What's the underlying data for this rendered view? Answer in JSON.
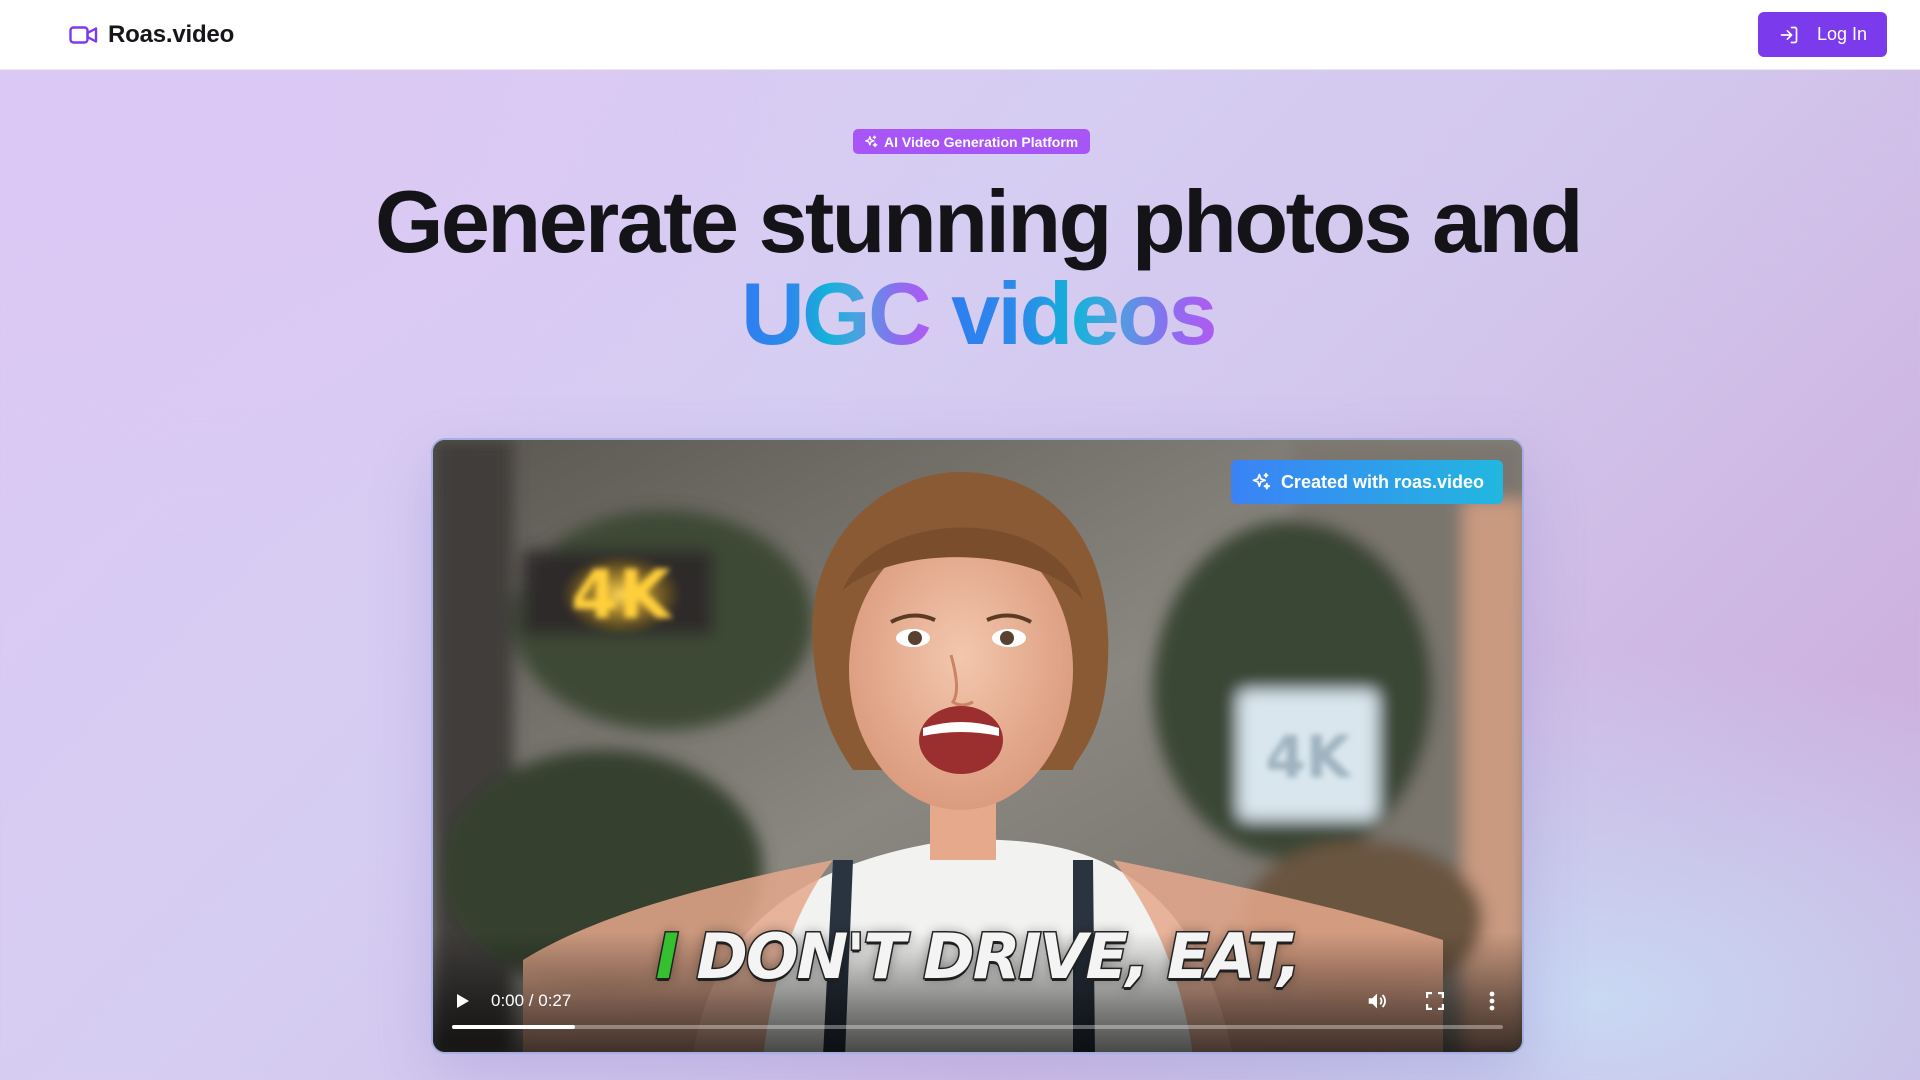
{
  "navbar": {
    "brand_name": "Roas.video",
    "brand_icon": "video-camera-icon",
    "login_label": "Log In",
    "login_icon": "log-in-icon"
  },
  "hero": {
    "badge_label": "AI Video Generation Platform",
    "badge_icon": "sparkles-icon",
    "headline_line1": "Generate stunning photos and",
    "headline_word1": "UGC",
    "headline_word2": "videos"
  },
  "video": {
    "watermark_label": "Created with roas.video",
    "watermark_icon": "sparkles-icon",
    "caption_first_word": "I",
    "caption_rest": "DON'T DRIVE, EAT,",
    "time_display": "0:00 / 0:27",
    "buffered_fraction": 0.117,
    "controls": [
      "play-icon",
      "volume-icon",
      "fullscreen-icon",
      "more-options-icon"
    ]
  },
  "colors": {
    "brand_purple": "#7c3aed",
    "badge_purple": "#a855f7",
    "watermark_blue": "#3b82f6",
    "watermark_cyan": "#22b7e0",
    "caption_green": "#35c030"
  }
}
